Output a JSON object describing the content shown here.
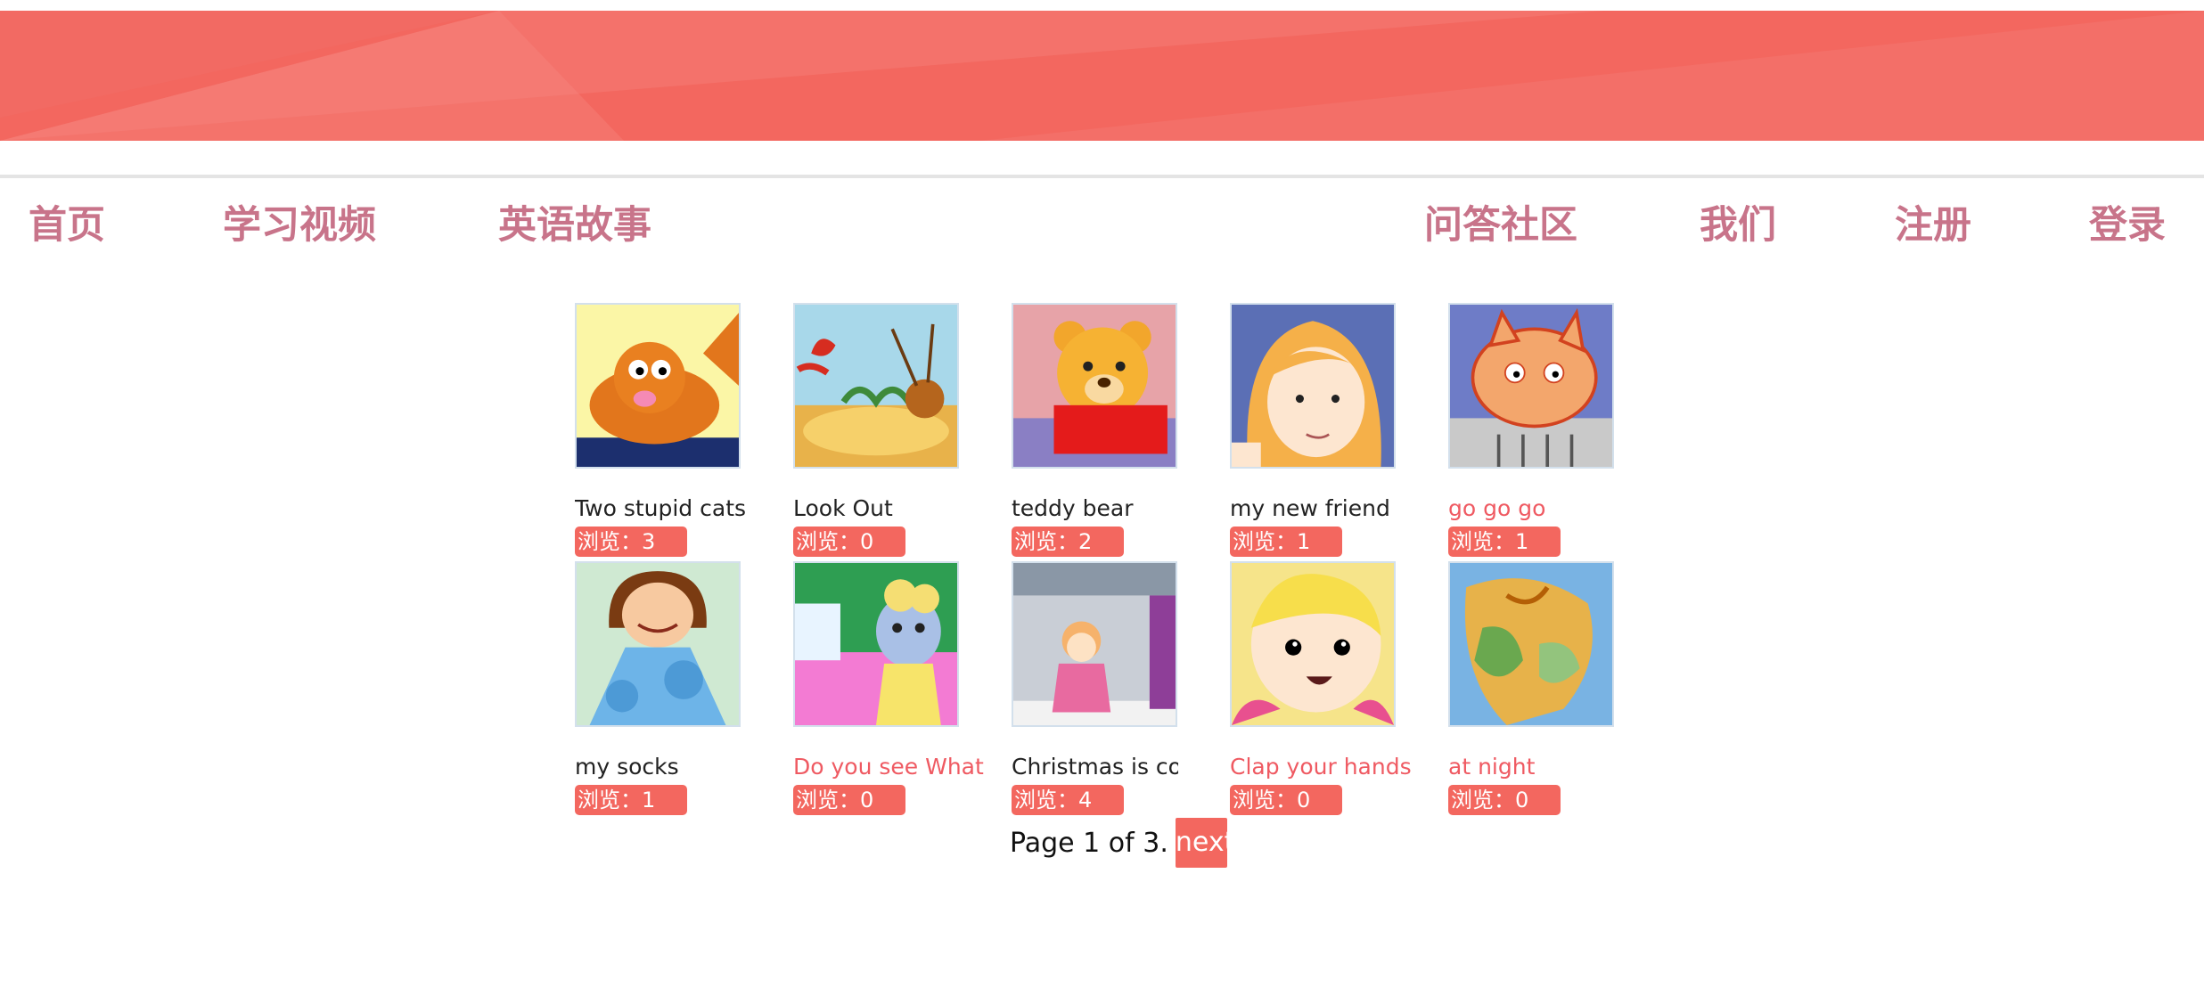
{
  "nav": {
    "home": "首页",
    "videos": "学习视频",
    "stories": "英语故事",
    "qa": "问答社区",
    "about": "我们",
    "register": "注册",
    "login": "登录"
  },
  "stories": [
    {
      "title": "Two stupid cats",
      "views": "浏览：3",
      "highlight": false,
      "icon": "cat-cartoon"
    },
    {
      "title": "Look Out",
      "views": "浏览：0",
      "highlight": false,
      "icon": "lobster-cartoon"
    },
    {
      "title": "teddy bear",
      "views": "浏览：2",
      "highlight": false,
      "icon": "teddy-bear"
    },
    {
      "title": "my new friend",
      "views": "浏览：1",
      "highlight": false,
      "icon": "girl-cartoon"
    },
    {
      "title": "go go go",
      "views": "浏览：1",
      "highlight": true,
      "icon": "cat-sketch"
    },
    {
      "title": "my socks",
      "views": "浏览：1",
      "highlight": false,
      "icon": "girl-dress"
    },
    {
      "title": "Do you see What",
      "views": "浏览：0",
      "highlight": true,
      "icon": "animal-kitchen"
    },
    {
      "title": "Christmas is coming",
      "views": "浏览：4",
      "highlight": false,
      "icon": "winter-girl"
    },
    {
      "title": "Clap your hands",
      "views": "浏览：0",
      "highlight": true,
      "icon": "baby-face"
    },
    {
      "title": "at night",
      "views": "浏览：0",
      "highlight": true,
      "icon": "abstract-colors"
    }
  ],
  "pagination": {
    "text": "Page 1 of 3.",
    "next_label": "next"
  },
  "colors": {
    "accent": "#f3675f",
    "nav_text": "#c8748a",
    "highlight_title": "#ef5a62"
  }
}
